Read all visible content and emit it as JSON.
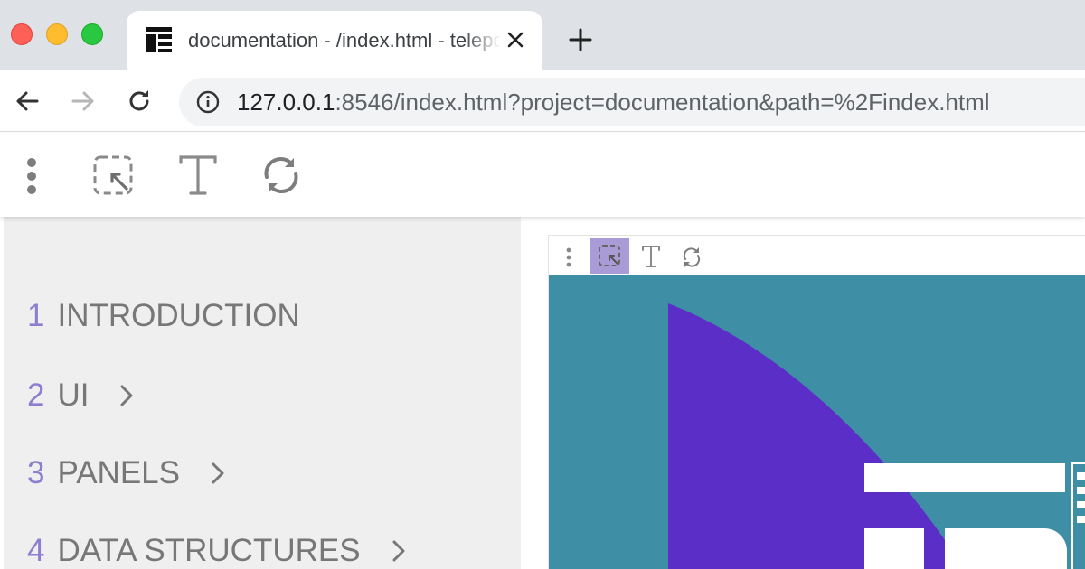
{
  "browser": {
    "tab": {
      "title": "documentation - /index.html - teleport",
      "favicon": "teleport-logo-icon"
    },
    "new_tab_label": "+",
    "url": {
      "host": "127.0.0.1",
      "rest": ":8546/index.html?project=documentation&path=%2Findex.html"
    }
  },
  "toolbar": {
    "icons": [
      "more-vert-icon",
      "select-cursor-icon",
      "text-icon",
      "reload-icon"
    ]
  },
  "sidebar": {
    "items": [
      {
        "num": "1",
        "label": "INTRODUCTION",
        "has_children": false
      },
      {
        "num": "2",
        "label": "UI",
        "has_children": true
      },
      {
        "num": "3",
        "label": "PANELS",
        "has_children": true
      },
      {
        "num": "4",
        "label": "DATA STRUCTURES",
        "has_children": true
      }
    ]
  },
  "preview": {
    "mini_toolbar": {
      "active": "select-cursor-icon"
    },
    "colors": {
      "background": "#3e8ea6",
      "shape": "#5b2ec8",
      "logo": "#ffffff"
    }
  }
}
